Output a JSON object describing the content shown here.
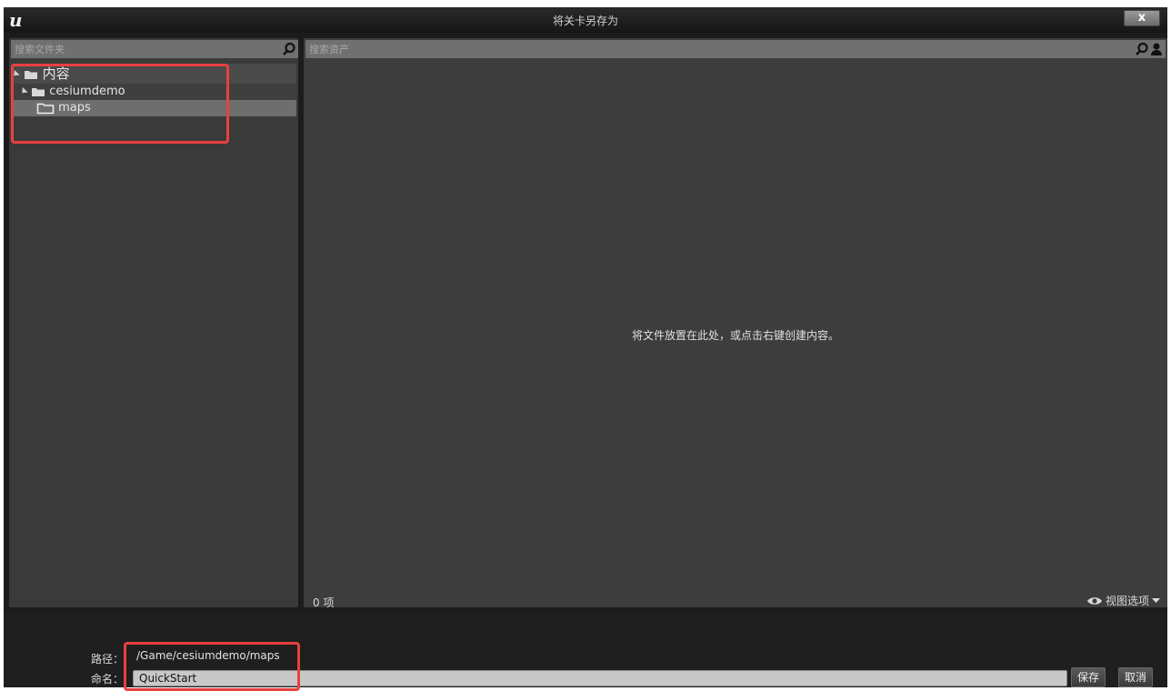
{
  "window": {
    "title": "将关卡另存为",
    "close_label": "x"
  },
  "left": {
    "search_placeholder": "搜索文件夹",
    "tree": [
      {
        "label": "内容"
      },
      {
        "label": "cesiumdemo"
      },
      {
        "label": "maps"
      }
    ]
  },
  "right": {
    "search_placeholder": "搜索资产",
    "empty_message": "将文件放置在此处，或点击右键创建内容。",
    "item_count": "0 项",
    "view_options": "视图选项"
  },
  "bottom": {
    "path_label": "路径：",
    "path_value": "/Game/cesiumdemo/maps",
    "name_label": "命名：",
    "name_value": "QuickStart",
    "save_label": "保存",
    "cancel_label": "取消"
  },
  "colors": {
    "highlight_box": "#e8413f",
    "panel": "#3d3d3d",
    "background": "#1c1c1c"
  }
}
